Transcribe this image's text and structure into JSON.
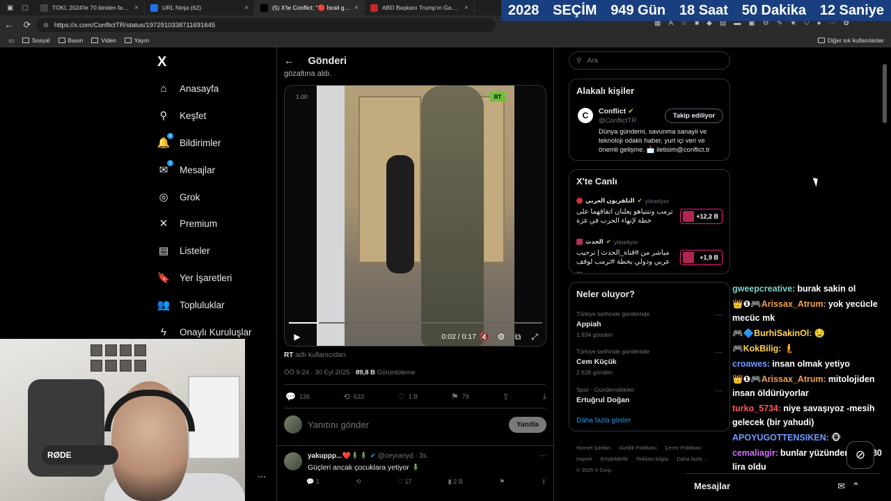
{
  "browser": {
    "tabs": [
      {
        "title": "TOKİ, 2024'te 70 binden fazla ko",
        "favicon_color": "#444",
        "active": false
      },
      {
        "title": "URL Ninja (62)",
        "favicon_color": "#1a73e8",
        "active": false
      },
      {
        "title": "(5) X'te Conflict: \"🔴 İsrail güçle",
        "favicon_color": "#000",
        "active": true
      },
      {
        "title": "ABD Başkanı Trump'ın Gazze plan",
        "favicon_color": "#c62828",
        "active": false
      }
    ],
    "url": "https://x.com/ConflictTR/status/1972910338711691645",
    "bookmarks": [
      "Sosyal",
      "Basın",
      "Video",
      "Yayın"
    ],
    "other_bookmarks": "Diğer sık kullanılanlar"
  },
  "countdown": {
    "year": "2028",
    "label": "SEÇİM",
    "days": "949 Gün",
    "hours": "18 Saat",
    "minutes": "50 Dakika",
    "seconds": "12 Saniye"
  },
  "sidebar": {
    "logo": "X",
    "items": [
      {
        "label": "Anasayfa",
        "icon": "home-icon",
        "glyph": "⌂"
      },
      {
        "label": "Keşfet",
        "icon": "search-icon",
        "glyph": "⚲"
      },
      {
        "label": "Bildirimler",
        "icon": "bell-icon",
        "glyph": "🔔",
        "badge": "4"
      },
      {
        "label": "Mesajlar",
        "icon": "mail-icon",
        "glyph": "✉",
        "badge": "1"
      },
      {
        "label": "Grok",
        "icon": "grok-icon",
        "glyph": "◎"
      },
      {
        "label": "Premium",
        "icon": "x-premium-icon",
        "glyph": "✕"
      },
      {
        "label": "Listeler",
        "icon": "list-icon",
        "glyph": "▤"
      },
      {
        "label": "Yer İşaretleri",
        "icon": "bookmark-icon",
        "glyph": "🔖"
      },
      {
        "label": "Topluluklar",
        "icon": "communities-icon",
        "glyph": "👥"
      },
      {
        "label": "Onaylı Kuruluşlar",
        "icon": "lightning-icon",
        "glyph": "ϟ"
      }
    ]
  },
  "post": {
    "header": "Gönderi",
    "snippet": "gözaltına aldı.",
    "video": {
      "speed": "1.00",
      "watermark": "RT",
      "time": "0:02 / 0:17",
      "progress": 0.118
    },
    "source_handle": "RT",
    "source_suffix": "adlı kullanıcıdan",
    "timestamp": "ÖÖ 9:24 · 30 Eyl 2025 ·",
    "views": "89,8 B",
    "views_label": "Görüntüleme",
    "actions": {
      "replies": "136",
      "reposts": "633",
      "likes": "1 B",
      "bookmarks": "79"
    },
    "reply_placeholder": "Yanıtını gönder",
    "reply_button": "Yanıtla"
  },
  "reply": {
    "name": "yakuppp...❤️🧍‍♂️🧍‍♂️",
    "handle": "@ceyranyd · 3s",
    "text": "Güçleri ancak çocuklara yetiyor 🧍‍♂️",
    "actions": {
      "replies": "1",
      "likes": "17",
      "views": "2 B"
    }
  },
  "right": {
    "search_placeholder": "Ara",
    "people_title": "Alakalı kişiler",
    "person": {
      "initial": "C",
      "name": "Conflict",
      "handle": "@ConflictTR",
      "bio": "Dünya gündemi, savunma sanayii ve teknoloji odaklı haber, yurt içi veri ve önemli gelişme. 📩 iletisim@conflict.tr",
      "follow": "Takip ediliyor"
    },
    "live_title": "X'te Canlı",
    "live": [
      {
        "host": "التلفزيون العربي",
        "status": "yönetiyor",
        "title": "ترمب ونتنياهو يعلنان اتفاقهما على خطة لإنهاء الحرب في غزة",
        "count": "+12,2 B"
      },
      {
        "host": "الحدث",
        "status": "yönetiyor",
        "title": "مباشر من #قناة_الحدث | ترحيب عربي ودولي بخطة #ترمب لوقف ...",
        "count": "+1,9 B"
      }
    ],
    "trends_title": "Neler oluyor?",
    "trends": [
      {
        "context": "Türkiye tarihinde gündemde",
        "name": "Appiah",
        "count": "1.934 gönderi"
      },
      {
        "context": "Türkiye tarihinde gündemde",
        "name": "Cem Küçük",
        "count": "2.628 gönderi"
      },
      {
        "context": "Spor · Gündemdekiler",
        "name": "Ertuğrul Doğan",
        "count": ""
      }
    ],
    "show_more": "Daha fazla göster",
    "footer": [
      "Hizmet Şartları",
      "Gizlilik Politikası",
      "Çerez Politikası",
      "Imprint",
      "Erişilebilirlik",
      "Reklam bilgisi",
      "Daha fazla ...",
      "© 2025 X Corp."
    ]
  },
  "chat": [
    {
      "user": "gweepcreative:",
      "color": "#7fd1c7",
      "text": "burak sakin ol",
      "prefix": ""
    },
    {
      "user": "Arissax_Atrum:",
      "color": "#f0a050",
      "text": "yok yecücle mecüc mk",
      "prefix": "👑❶🎮"
    },
    {
      "user": "BurhiSakinOl:",
      "color": "#ffd34d",
      "text": "🤤",
      "prefix": "🎮🔷"
    },
    {
      "user": "KokBilig:",
      "color": "#ffd34d",
      "text": "🧜",
      "prefix": "🎮"
    },
    {
      "user": "croawes:",
      "color": "#6f9cff",
      "text": "insan olmak yetiyo",
      "prefix": ""
    },
    {
      "user": "Arissax_Atrum:",
      "color": "#f0a050",
      "text": "mitolojiden insan öldürüyorlar",
      "prefix": "👑❶🎮"
    },
    {
      "user": "turko_5734:",
      "color": "#ff5a5a",
      "text": "niye savaşıyoz -mesih gelecek (bir yahudi)",
      "prefix": ""
    },
    {
      "user": "APOYUGOTTENSIKEN:",
      "color": "#6f9cff",
      "text": "🐵",
      "prefix": ""
    },
    {
      "user": "cemaliagir:",
      "color": "#d070ff",
      "text": "bunlar yüzünden kola 80 lira oldu",
      "prefix": ""
    }
  ],
  "messages_tab": "Mesajlar",
  "webcam": {
    "mic_brand": "RØDE"
  },
  "colors": {
    "accent": "#1d9bf0",
    "live": "#f91880",
    "countdown_bg": "#1a3f80"
  }
}
